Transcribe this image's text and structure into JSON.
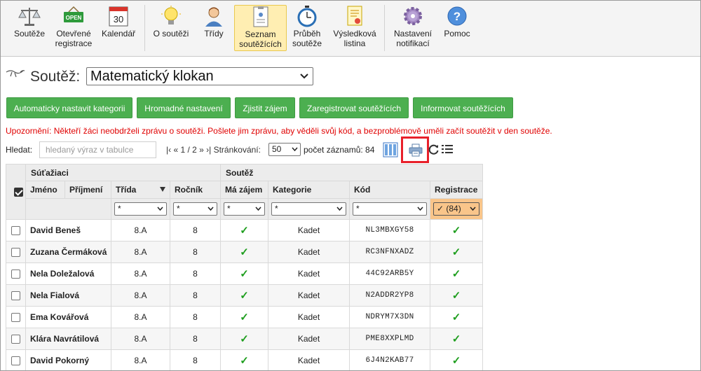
{
  "toolbar": {
    "items": [
      {
        "label": "Soutěže",
        "icon": "scales-icon"
      },
      {
        "label": "Otevřené registrace",
        "icon": "open-sign-icon",
        "sign_text": "OPEN"
      },
      {
        "label": "Kalendář",
        "icon": "calendar-icon",
        "day": "30"
      },
      {
        "label": "O soutěži",
        "icon": "lightbulb-icon"
      },
      {
        "label": "Třídy",
        "icon": "student-icon"
      },
      {
        "label": "Seznam soutěžících",
        "icon": "contestant-list-icon"
      },
      {
        "label": "Průběh soutěže",
        "icon": "stopwatch-icon"
      },
      {
        "label": "Výsledková listina",
        "icon": "certificate-icon"
      },
      {
        "label": "Nastavení notifikací",
        "icon": "gear-icon"
      },
      {
        "label": "Pomoc",
        "icon": "help-icon",
        "symbol": "?"
      }
    ],
    "active": "Seznam soutěžících"
  },
  "competition": {
    "label": "Soutěž:",
    "selected": "Matematický klokan"
  },
  "buttons": {
    "auto_category": "Automaticky nastavit kategorii",
    "bulk_settings": "Hromadné nastavení",
    "check_interest": "Zjistit zájem",
    "register": "Zaregistrovat soutěžících",
    "inform": "Informovat soutěžících"
  },
  "warning": "Upozornění: Někteří žáci neobdrželi zprávu o soutěži. Pošlete jim zprávu, aby věděli svůj kód, a bezproblémově uměli začít soutěžit v den soutěže.",
  "search": {
    "label": "Hledat:",
    "placeholder": "hledaný výraz v tabulce",
    "pager_text": "|‹ « 1 / 2 » ›| Stránkování:",
    "page_size": "50",
    "count_text": "počet záznamů: 84"
  },
  "table": {
    "group_contestants": "Súťažiaci",
    "group_competition": "Soutěž",
    "columns": {
      "first_name": "Jméno",
      "last_name": "Příjmení",
      "class": "Třída",
      "year": "Ročník",
      "interest": "Má zájem",
      "category": "Kategorie",
      "code": "Kód",
      "registration": "Registrace"
    },
    "filters": {
      "class": "*",
      "year": "*",
      "interest": "*",
      "category": "*",
      "code": "*",
      "registration": "✓ (84)"
    },
    "tick": "✓",
    "rows": [
      {
        "name": "David Beneš",
        "class": "8.A",
        "year": "8",
        "category": "Kadet",
        "code": "NL3MBXGY58"
      },
      {
        "name": "Zuzana Čermáková",
        "class": "8.A",
        "year": "8",
        "category": "Kadet",
        "code": "RC3NFNXADZ"
      },
      {
        "name": "Nela Doležalová",
        "class": "8.A",
        "year": "8",
        "category": "Kadet",
        "code": "44C92ARB5Y"
      },
      {
        "name": "Nela Fialová",
        "class": "8.A",
        "year": "8",
        "category": "Kadet",
        "code": "N2ADDR2YP8"
      },
      {
        "name": "Ema Kovářová",
        "class": "8.A",
        "year": "8",
        "category": "Kadet",
        "code": "NDRYM7X3DN"
      },
      {
        "name": "Klára Navrátilová",
        "class": "8.A",
        "year": "8",
        "category": "Kadet",
        "code": "PME8XXPLMD"
      },
      {
        "name": "David Pokorný",
        "class": "8.A",
        "year": "8",
        "category": "Kadet",
        "code": "6J4N2KAB77"
      }
    ]
  }
}
